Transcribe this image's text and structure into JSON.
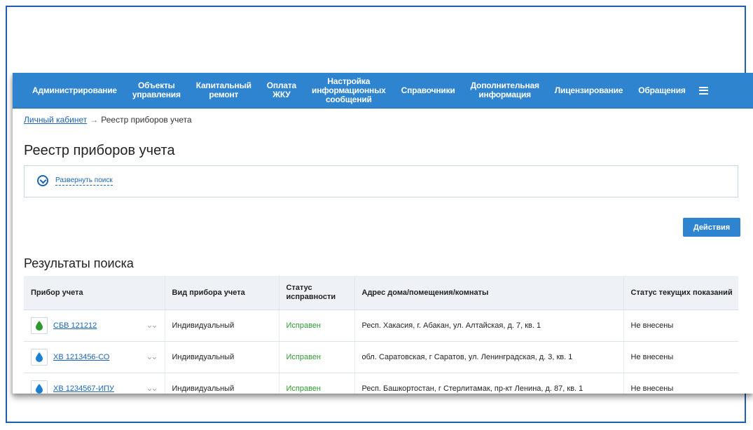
{
  "nav": {
    "items": [
      "Администрирование",
      "Объекты\nуправления",
      "Капитальный\nремонт",
      "Оплата\nЖКУ",
      "Настройка\nинформационных\nсообщений",
      "Справочники",
      "Дополнительная\nинформация",
      "Лицензирование",
      "Обращения"
    ]
  },
  "breadcrumb": {
    "home": "Личный кабинет",
    "arrow": "→",
    "current": "Реестр приборов учета"
  },
  "page": {
    "title": "Реестр приборов учета"
  },
  "search": {
    "toggle_label": "Развернуть поиск"
  },
  "actions": {
    "label": "Действия"
  },
  "results": {
    "title": "Результаты поиска",
    "columns": [
      "Прибор учета",
      "Вид прибора учета",
      "Статус\nисправности",
      "Адрес дома/помещения/комнаты",
      "Статус текущих показаний"
    ],
    "rows": [
      {
        "device": "СБВ 121212",
        "drop_color": "#2e9a2e",
        "type": "Индивидуальный",
        "status": "Исправен",
        "address": "Респ. Хакасия, г. Абакан, ул. Алтайская, д. 7, кв. 1",
        "reading_status": "Не внесены"
      },
      {
        "device": "ХВ 1213456-СО",
        "drop_color": "#1d7fd1",
        "type": "Индивидуальный",
        "status": "Исправен",
        "address": "обл. Саратовская, г Саратов, ул. Ленинградская, д. 3, кв. 1",
        "reading_status": "Не внесены"
      },
      {
        "device": "ХВ 1234567-ИПУ",
        "drop_color": "#1d7fd1",
        "type": "Индивидуальный",
        "status": "Исправен",
        "address": "Респ. Башкортостан, г Стерлитамак, пр-кт Ленина, д. 87, кв. 1",
        "reading_status": "Не внесены"
      }
    ]
  }
}
